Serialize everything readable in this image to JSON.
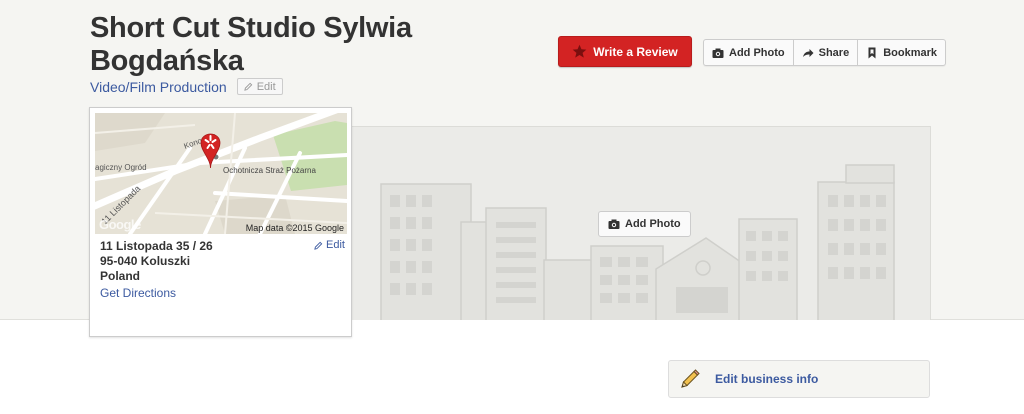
{
  "business": {
    "name": "Short Cut Studio Sylwia Bogdańska",
    "category": "Video/Film Production",
    "category_edit_label": "Edit"
  },
  "actions": {
    "write_review_label": "Write a Review",
    "add_photo_label": "Add Photo",
    "share_label": "Share",
    "bookmark_label": "Bookmark"
  },
  "photo_area": {
    "add_photo_label": "Add Photo"
  },
  "map": {
    "labels": {
      "street_konop": "Konopnic",
      "ogrod": "agiczny Ogród",
      "listopada": "11 Listopada",
      "straz": "Ochotnicza Straż Pożarna",
      "google": "Google"
    },
    "credit": "Map data ©2015 Google",
    "edit_label": "Edit",
    "address_line1": "11 Listopada 35 / 26",
    "address_line2": "95-040 Koluszki",
    "address_line3": "Poland",
    "directions_label": "Get Directions"
  },
  "edit_business": {
    "label": "Edit business info"
  },
  "colors": {
    "brand_red": "#d32323",
    "link_blue": "#3c5aa0"
  },
  "icons": {
    "review": "star-icon",
    "add_photo": "camera-icon",
    "share": "share-arrow-icon",
    "bookmark": "bookmark-icon",
    "edit": "pencil-icon",
    "map_pin": "map-pin-icon"
  }
}
